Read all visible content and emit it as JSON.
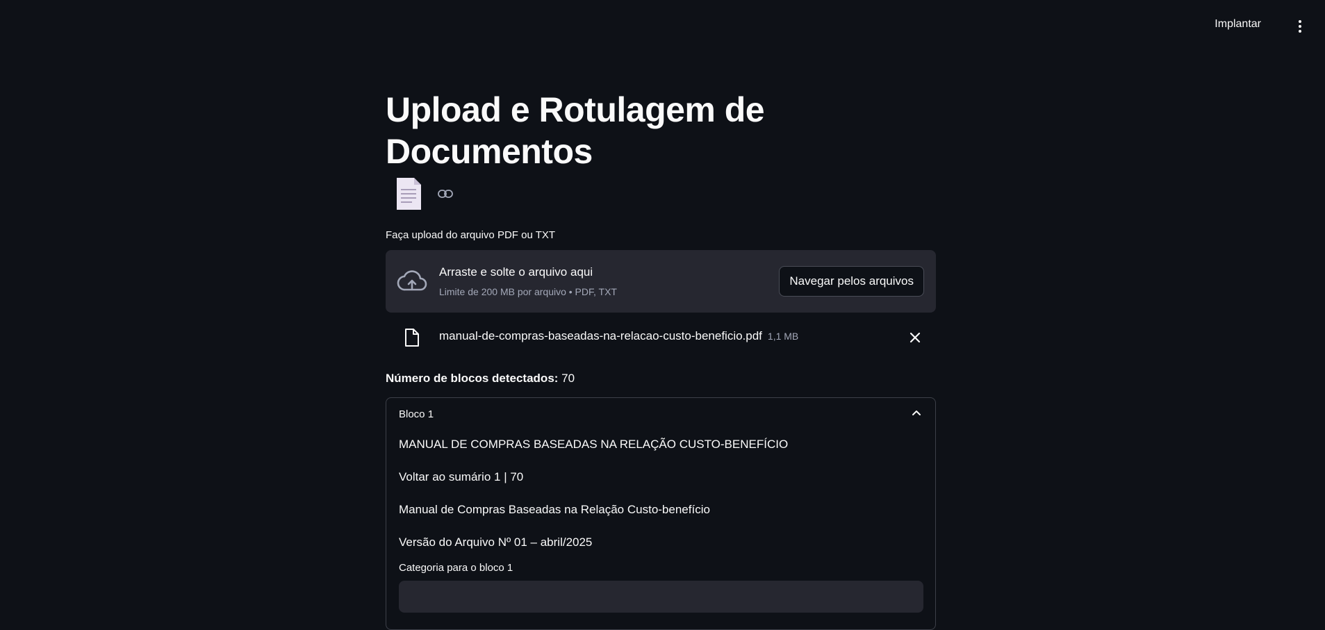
{
  "header": {
    "deploy_label": "Implantar"
  },
  "page": {
    "title": "Upload e Rotulagem de Documentos"
  },
  "uploader": {
    "label": "Faça upload do arquivo PDF ou TXT",
    "drop_text": "Arraste e solte o arquivo aqui",
    "limit_text": "Limite de 200 MB por arquivo • PDF, TXT",
    "browse_label": "Navegar pelos arquivos"
  },
  "uploaded_file": {
    "name": "manual-de-compras-baseadas-na-relacao-custo-beneficio.pdf",
    "size": "1,1 MB"
  },
  "blocks": {
    "count_label": "Número de blocos detectados:",
    "count_value": "70"
  },
  "expander": {
    "title": "Bloco 1",
    "paragraphs": [
      "MANUAL DE COMPRAS BASEADAS NA RELAÇÃO CUSTO-BENEFÍCIO",
      "Voltar ao sumário 1 | 70",
      "Manual de Compras Baseadas na Relação Custo-benefício",
      "Versão do Arquivo Nº 01 – abril/2025"
    ],
    "category_label": "Categoria para o bloco 1",
    "category_value": ""
  },
  "colors": {
    "background": "#0e1117",
    "surface": "#262730",
    "text": "#fafafa",
    "muted": "#a3a8b8",
    "border": "#3d4049"
  },
  "icons": [
    "document-emoji-icon",
    "link-icon",
    "cloud-upload-icon",
    "file-icon",
    "close-icon",
    "chevron-up-icon",
    "kebab-menu-icon"
  ]
}
